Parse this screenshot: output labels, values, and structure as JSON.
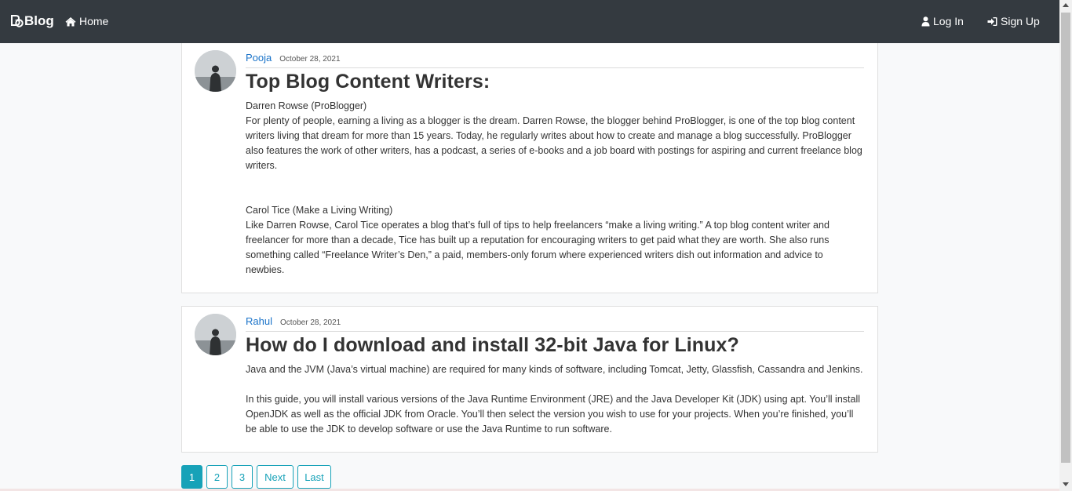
{
  "nav": {
    "brand": "Blog",
    "home": "Home",
    "login": "Log In",
    "signup": "Sign Up"
  },
  "posts": [
    {
      "author": "Pooja",
      "date": "October 28, 2021",
      "title": "Top Blog Content Writers:",
      "paragraphs": [
        "Darren Rowse (ProBlogger)",
        "For plenty of people, earning a living as a blogger is the dream. Darren Rowse, the blogger behind ProBlogger, is one of the top blog content writers living that dream for more than 15 years. Today, he regularly writes about how to create and manage a blog successfully. ProBlogger also features the work of other writers, has a podcast, a series of e-books and a job board with postings for aspiring and current freelance blog writers.",
        "Carol Tice (Make a Living Writing)",
        "Like Darren Rowse, Carol Tice operates a blog that’s full of tips to help freelancers “make a living writing.” A top blog content writer and freelancer for more than a decade, Tice has built up a reputation for encouraging writers to get paid what they are worth. She also runs something called “Freelance Writer’s Den,” a paid, members-only forum where experienced writers dish out information and advice to newbies."
      ]
    },
    {
      "author": "Rahul",
      "date": "October 28, 2021",
      "title": "How do I download and install 32-bit Java for Linux?",
      "paragraphs": [
        "Java and the JVM (Java’s virtual machine) are required for many kinds of software, including Tomcat, Jetty, Glassfish, Cassandra and Jenkins.",
        "In this guide, you will install various versions of the Java Runtime Environment (JRE) and the Java Developer Kit (JDK) using apt. You’ll install OpenJDK as well as the official JDK from Oracle. You’ll then select the version you wish to use for your projects. When you’re finished, you’ll be able to use the JDK to develop software or use the Java Runtime to run software."
      ]
    }
  ],
  "pagination": {
    "pages": [
      "1",
      "2",
      "3"
    ],
    "active": "1",
    "next": "Next",
    "last": "Last"
  },
  "colors": {
    "navbar": "#343a40",
    "accent": "#17a2b8",
    "author_link": "#1a73c9"
  }
}
